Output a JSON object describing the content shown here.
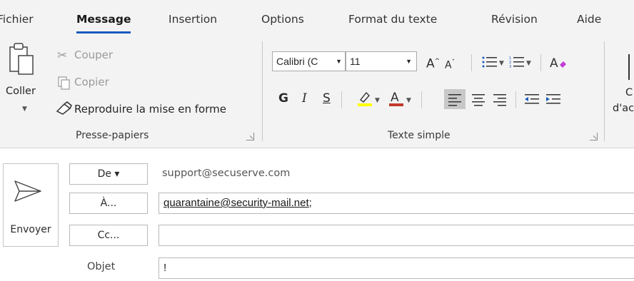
{
  "tabs": [
    {
      "label": "Fichier"
    },
    {
      "label": "Message"
    },
    {
      "label": "Insertion"
    },
    {
      "label": "Options"
    },
    {
      "label": "Format du texte"
    },
    {
      "label": "Révision"
    },
    {
      "label": "Aide"
    }
  ],
  "ribbon": {
    "clipboard": {
      "paste_label": "Coller",
      "cut_label": "Couper",
      "copy_label": "Copier",
      "format_painter_label": "Reproduire la mise en forme",
      "group_label": "Presse-papiers"
    },
    "basic_text": {
      "font_name": "Calibri (C",
      "font_size": "11",
      "bold_label": "G",
      "italic_label": "I",
      "underline_label": "S",
      "group_label": "Texte simple",
      "highlight_color": "#ffff00",
      "font_color": "#c0392b"
    },
    "next_group": {
      "label_top": "C",
      "label_bottom": "d'ac"
    }
  },
  "mail": {
    "send_label": "Envoyer",
    "from_button": "De ▾",
    "from_value": "support@secuserve.com",
    "to_button": "À...",
    "to_value": "quarantaine@security-mail.net",
    "to_separator": ";",
    "cc_button": "Cc...",
    "cc_value": "",
    "subject_label": "Objet",
    "subject_value": "!"
  },
  "colors": {
    "accent": "#185abd",
    "ribbon_bg": "#f3f3f3"
  }
}
